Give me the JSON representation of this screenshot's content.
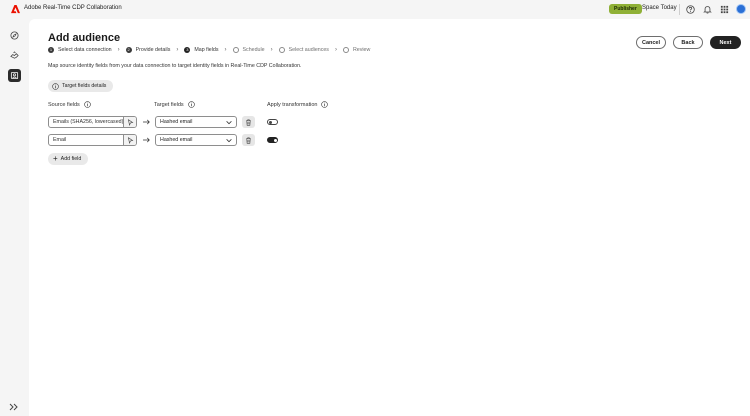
{
  "app": {
    "title": "Adobe Real-Time CDP Collaboration",
    "brand_color": "#eb1000"
  },
  "header": {
    "badge": "Publisher",
    "org_name": "Space Today",
    "icons": [
      "help-icon",
      "bell-icon",
      "apps-grid-icon",
      "avatar"
    ]
  },
  "rail": {
    "items": [
      "compass-icon",
      "handshake-icon",
      "audience-icon"
    ],
    "active_index": 2,
    "bottom": "expand-chevrons-icon"
  },
  "page": {
    "title": "Add audience",
    "description": "Map source identity fields from your data connection to target identity fields in Real-Time CDP Collaboration."
  },
  "steps": [
    {
      "num": "1",
      "label": "Select data connection",
      "state": "done"
    },
    {
      "num": "2",
      "label": "Provide details",
      "state": "done"
    },
    {
      "num": "3",
      "label": "Map fields",
      "state": "current"
    },
    {
      "num": "",
      "label": "Schedule",
      "state": "future"
    },
    {
      "num": "",
      "label": "Select audiences",
      "state": "future"
    },
    {
      "num": "",
      "label": "Review",
      "state": "future"
    }
  ],
  "actions": {
    "cancel": "Cancel",
    "back": "Back",
    "next": "Next"
  },
  "info_button": "Target fields details",
  "columns": {
    "source": "Source fields",
    "target": "Target fields",
    "transform": "Apply transformation"
  },
  "rows": [
    {
      "source": "Emails (SHA256, lowercased)",
      "target": "Hashed email",
      "transform_on": false
    },
    {
      "source": "Email",
      "target": "Hashed email",
      "transform_on": true
    }
  ],
  "add_field": "Add field"
}
